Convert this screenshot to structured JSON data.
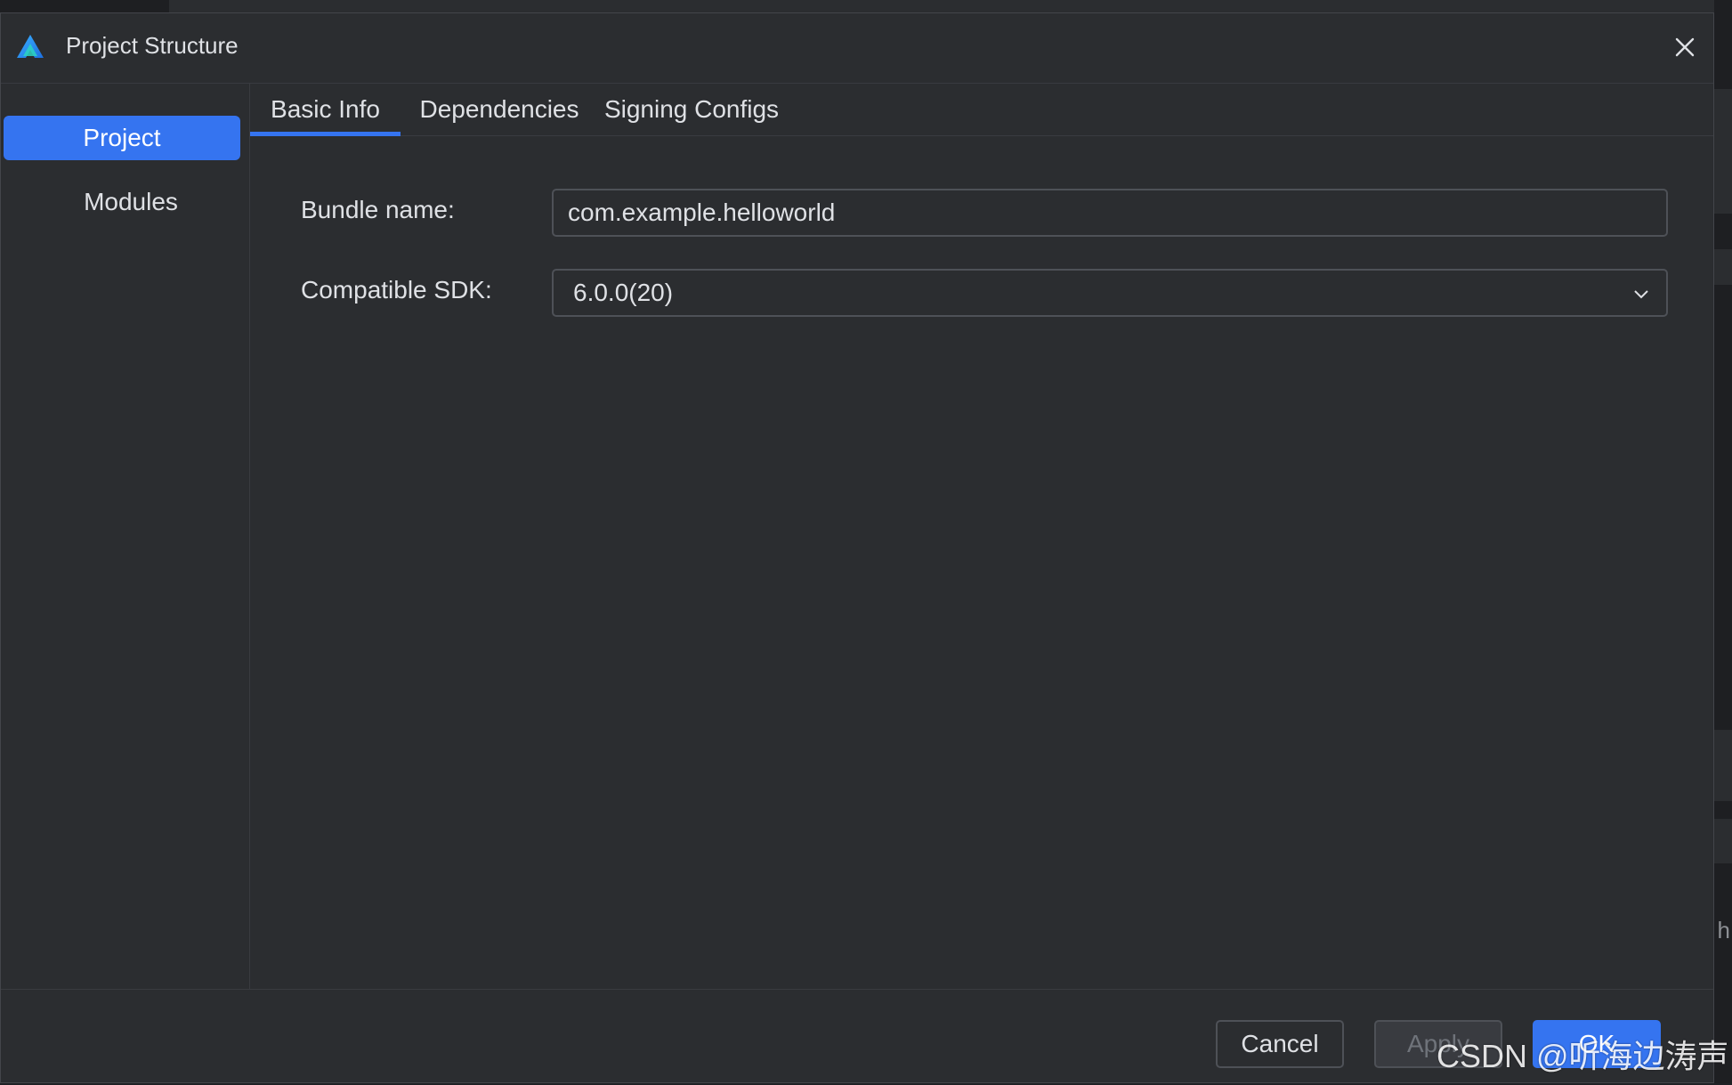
{
  "dialog": {
    "title": "Project Structure",
    "close_icon": "close-icon",
    "app_icon": "app-logo-icon"
  },
  "sidebar": {
    "items": [
      {
        "label": "Project",
        "active": true
      },
      {
        "label": "Modules",
        "active": false
      }
    ]
  },
  "tabs": [
    {
      "label": "Basic Info",
      "active": true
    },
    {
      "label": "Dependencies",
      "active": false
    },
    {
      "label": "Signing Configs",
      "active": false
    }
  ],
  "form": {
    "bundle_name_label": "Bundle name:",
    "bundle_name_value": "com.example.helloworld",
    "sdk_label": "Compatible SDK:",
    "sdk_value": "6.0.0(20)"
  },
  "footer": {
    "cancel_label": "Cancel",
    "apply_label": "Apply",
    "ok_label": "OK"
  },
  "watermark": "CSDN @听海边涛声",
  "background_fragment": "h",
  "colors": {
    "accent": "#3574f0",
    "dialog_bg": "#2b2d30",
    "text": "#dfe1e5"
  }
}
